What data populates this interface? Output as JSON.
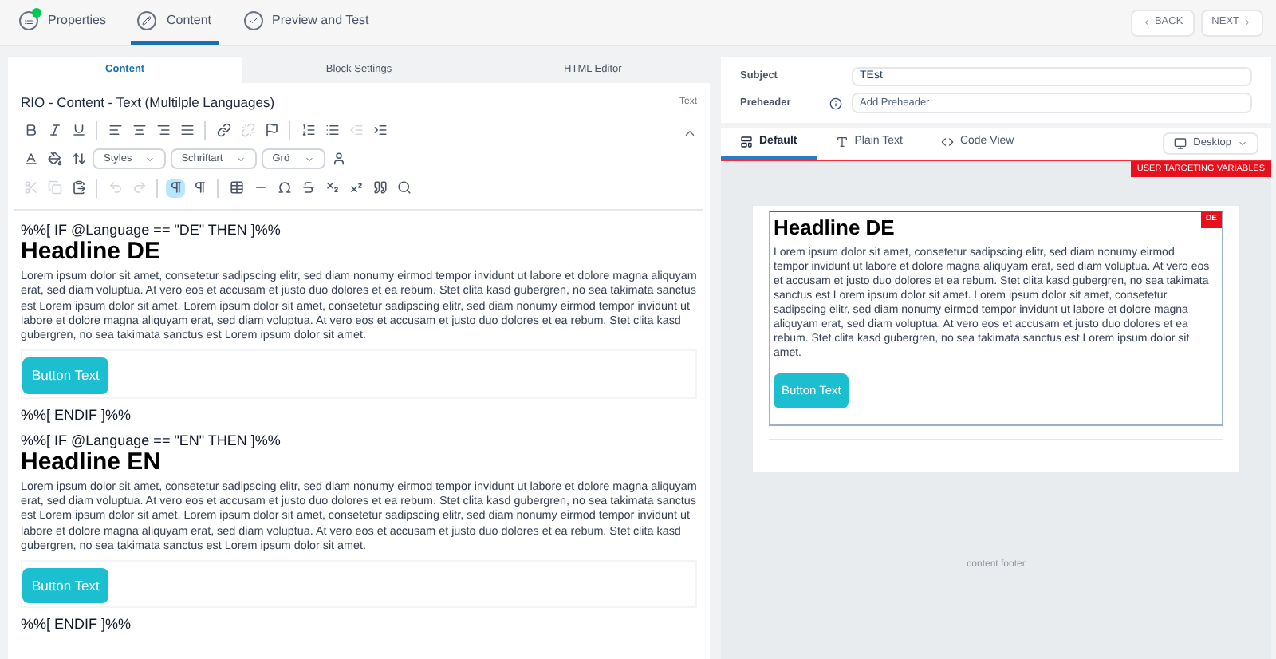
{
  "wizard_steps": [
    {
      "label": "Properties",
      "kind": "done",
      "selected": false
    },
    {
      "label": "Content",
      "kind": "edit",
      "selected": true
    },
    {
      "label": "Preview and Test",
      "kind": "check",
      "selected": false
    }
  ],
  "nav_buttons": [
    {
      "label": "BACK",
      "kind": "back"
    },
    {
      "label": "NEXT",
      "kind": "next"
    }
  ],
  "editor": {
    "tabs": [
      {
        "label": "Content",
        "selected": true
      },
      {
        "label": "Block Settings",
        "selected": false
      },
      {
        "label": "HTML Editor",
        "selected": false
      }
    ],
    "block_title": "RIO - Content - Text (Multilple Languages)",
    "block_type": "Text",
    "toolbar_rows": [
      [
        {
          "kind": "bold",
          "disabled": false,
          "active": false
        },
        {
          "kind": "italic",
          "disabled": false,
          "active": false
        },
        {
          "kind": "underline",
          "disabled": false,
          "active": false
        },
        {
          "kind": "sep"
        },
        {
          "kind": "align-left",
          "disabled": false,
          "active": false
        },
        {
          "kind": "align-center",
          "disabled": false,
          "active": false
        },
        {
          "kind": "align-right",
          "disabled": false,
          "active": false
        },
        {
          "kind": "justify",
          "disabled": false,
          "active": false
        },
        {
          "kind": "sep"
        },
        {
          "kind": "link",
          "disabled": false,
          "active": false
        },
        {
          "kind": "unlink",
          "disabled": true,
          "active": false
        },
        {
          "kind": "flag",
          "disabled": false,
          "active": false
        },
        {
          "kind": "sep"
        },
        {
          "kind": "ordered-list",
          "disabled": false,
          "active": false
        },
        {
          "kind": "bullet-list",
          "disabled": false,
          "active": false
        },
        {
          "kind": "outdent",
          "disabled": true,
          "active": false
        },
        {
          "kind": "indent",
          "disabled": false,
          "active": false
        }
      ],
      [
        {
          "kind": "text-color",
          "disabled": false,
          "active": false
        },
        {
          "kind": "bg-color",
          "disabled": false,
          "active": false
        },
        {
          "kind": "line-height",
          "disabled": false,
          "active": false
        },
        {
          "kind": "dropdown",
          "label": "Styles",
          "disabled": false,
          "active": false
        },
        {
          "kind": "dropdown",
          "label": "Schriftart",
          "disabled": false,
          "active": false
        },
        {
          "kind": "dropdown",
          "label": "Grö",
          "disabled": false,
          "active": false
        },
        {
          "kind": "person",
          "disabled": false,
          "active": false
        }
      ],
      [
        {
          "kind": "cut",
          "disabled": true,
          "active": false
        },
        {
          "kind": "copy",
          "disabled": true,
          "active": false
        },
        {
          "kind": "paste",
          "disabled": false,
          "active": false
        },
        {
          "kind": "sep"
        },
        {
          "kind": "undo",
          "disabled": true,
          "active": false
        },
        {
          "kind": "redo",
          "disabled": true,
          "active": false
        },
        {
          "kind": "sep"
        },
        {
          "kind": "ltr",
          "disabled": false,
          "active": true
        },
        {
          "kind": "rtl",
          "disabled": false,
          "active": false
        },
        {
          "kind": "sep"
        },
        {
          "kind": "table",
          "disabled": false,
          "active": false
        },
        {
          "kind": "hr",
          "disabled": false,
          "active": false
        },
        {
          "kind": "omega",
          "disabled": false,
          "active": false
        },
        {
          "kind": "strike",
          "disabled": false,
          "active": false
        },
        {
          "kind": "subscript",
          "disabled": false,
          "active": false
        },
        {
          "kind": "superscript",
          "disabled": false,
          "active": false
        },
        {
          "kind": "quote",
          "disabled": false,
          "active": false
        },
        {
          "kind": "search",
          "disabled": false,
          "active": false
        }
      ]
    ],
    "blocks": [
      {
        "kind": "code",
        "text": "%%[ IF @Language == \"DE\" THEN ]%%"
      },
      {
        "kind": "headline",
        "text": "Headline DE"
      },
      {
        "kind": "paragraph",
        "text": "Lorem ipsum dolor sit amet, consetetur sadipscing elitr, sed diam nonumy eirmod tempor invidunt ut labore et dolore magna aliquyam erat, sed diam voluptua. At vero eos et accusam et justo duo dolores et ea rebum. Stet clita kasd gubergren, no sea takimata sanctus est Lorem ipsum dolor sit amet. Lorem ipsum dolor sit amet, consetetur sadipscing elitr, sed diam nonumy eirmod tempor invidunt ut labore et dolore magna aliquyam erat, sed diam voluptua. At vero eos et accusam et justo duo dolores et ea rebum. Stet clita kasd gubergren, no sea takimata sanctus est Lorem ipsum dolor sit amet."
      },
      {
        "kind": "button",
        "text": "Button Text"
      },
      {
        "kind": "code",
        "text": "%%[ ENDIF ]%%"
      },
      {
        "kind": "code",
        "text": "%%[ IF @Language == \"EN\" THEN ]%%"
      },
      {
        "kind": "headline",
        "text": "Headline EN"
      },
      {
        "kind": "paragraph",
        "text": "Lorem ipsum dolor sit amet, consetetur sadipscing elitr, sed diam nonumy eirmod tempor invidunt ut labore et dolore magna aliquyam erat, sed diam voluptua. At vero eos et accusam et justo duo dolores et ea rebum. Stet clita kasd gubergren, no sea takimata sanctus est Lorem ipsum dolor sit amet. Lorem ipsum dolor sit amet, consetetur sadipscing elitr, sed diam nonumy eirmod tempor invidunt ut labore et dolore magna aliquyam erat, sed diam voluptua. At vero eos et accusam et justo duo dolores et ea rebum. Stet clita kasd gubergren, no sea takimata sanctus est Lorem ipsum dolor sit amet."
      },
      {
        "kind": "button",
        "text": "Button Text"
      },
      {
        "kind": "code",
        "text": "%%[ ENDIF ]%%"
      }
    ]
  },
  "preview": {
    "subject_label": "Subject",
    "subject_value": "TEst",
    "preheader_label": "Preheader",
    "preheader_placeholder": "Add Preheader",
    "tabs": [
      {
        "label": "Default",
        "kind": "layout",
        "selected": true
      },
      {
        "label": "Plain Text",
        "kind": "text",
        "selected": false
      },
      {
        "label": "Code View",
        "kind": "code",
        "selected": false
      }
    ],
    "device": "Desktop",
    "targeting_badge": "USER TARGETING VARIABLES",
    "headline": "Headline DE",
    "language_tag": "DE",
    "paragraph": "Lorem ipsum dolor sit amet, consetetur sadipscing elitr, sed diam nonumy eirmod tempor invidunt ut labore et dolore magna aliquyam erat, sed diam voluptua. At vero eos et accusam et justo duo dolores et ea rebum. Stet clita kasd gubergren, no sea takimata sanctus est Lorem ipsum dolor sit amet. Lorem ipsum dolor sit amet, consetetur sadipscing elitr, sed diam nonumy eirmod tempor invidunt ut labore et dolore magna aliquyam erat, sed diam voluptua. At vero eos et accusam et justo duo dolores et ea rebum. Stet clita kasd gubergren, no sea takimata sanctus est Lorem ipsum dolor sit amet.",
    "button": "Button Text",
    "footer": "content footer"
  }
}
